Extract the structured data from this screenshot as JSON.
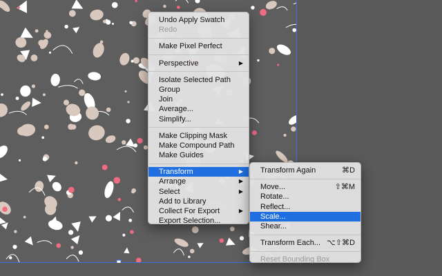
{
  "context_menu": {
    "items": [
      {
        "label": "Undo Apply Swatch"
      },
      {
        "label": "Redo",
        "disabled": true
      },
      {
        "separator": true
      },
      {
        "label": "Make Pixel Perfect"
      },
      {
        "separator": true
      },
      {
        "label": "Perspective",
        "submenu": true
      },
      {
        "separator": true
      },
      {
        "label": "Isolate Selected Path"
      },
      {
        "label": "Group"
      },
      {
        "label": "Join"
      },
      {
        "label": "Average..."
      },
      {
        "label": "Simplify..."
      },
      {
        "separator": true
      },
      {
        "label": "Make Clipping Mask"
      },
      {
        "label": "Make Compound Path"
      },
      {
        "label": "Make Guides"
      },
      {
        "separator": true
      },
      {
        "label": "Transform",
        "submenu": true,
        "highlighted": true
      },
      {
        "label": "Arrange",
        "submenu": true
      },
      {
        "label": "Select",
        "submenu": true
      },
      {
        "label": "Add to Library"
      },
      {
        "label": "Collect For Export",
        "submenu": true
      },
      {
        "label": "Export Selection..."
      }
    ]
  },
  "transform_submenu": {
    "items": [
      {
        "label": "Transform Again",
        "shortcut": "⌘D"
      },
      {
        "separator": true
      },
      {
        "label": "Move...",
        "shortcut": "⇧⌘M"
      },
      {
        "label": "Rotate..."
      },
      {
        "label": "Reflect..."
      },
      {
        "label": "Scale...",
        "highlighted": true
      },
      {
        "label": "Shear..."
      },
      {
        "separator": true
      },
      {
        "label": "Transform Each...",
        "shortcut": "⌥⇧⌘D"
      },
      {
        "separator": true
      },
      {
        "label": "Reset Bounding Box",
        "disabled": true
      }
    ]
  },
  "icons": {
    "submenu_arrow": "▶"
  },
  "colors": {
    "pasteboard": "#5a5a5a",
    "artboard": "#5e5e5e",
    "selection": "#3a6ee8",
    "highlight": "#1f6fe0",
    "pattern_beige": "#d9c8bd",
    "pattern_pink": "#f06a82",
    "pattern_white": "#ffffff"
  }
}
